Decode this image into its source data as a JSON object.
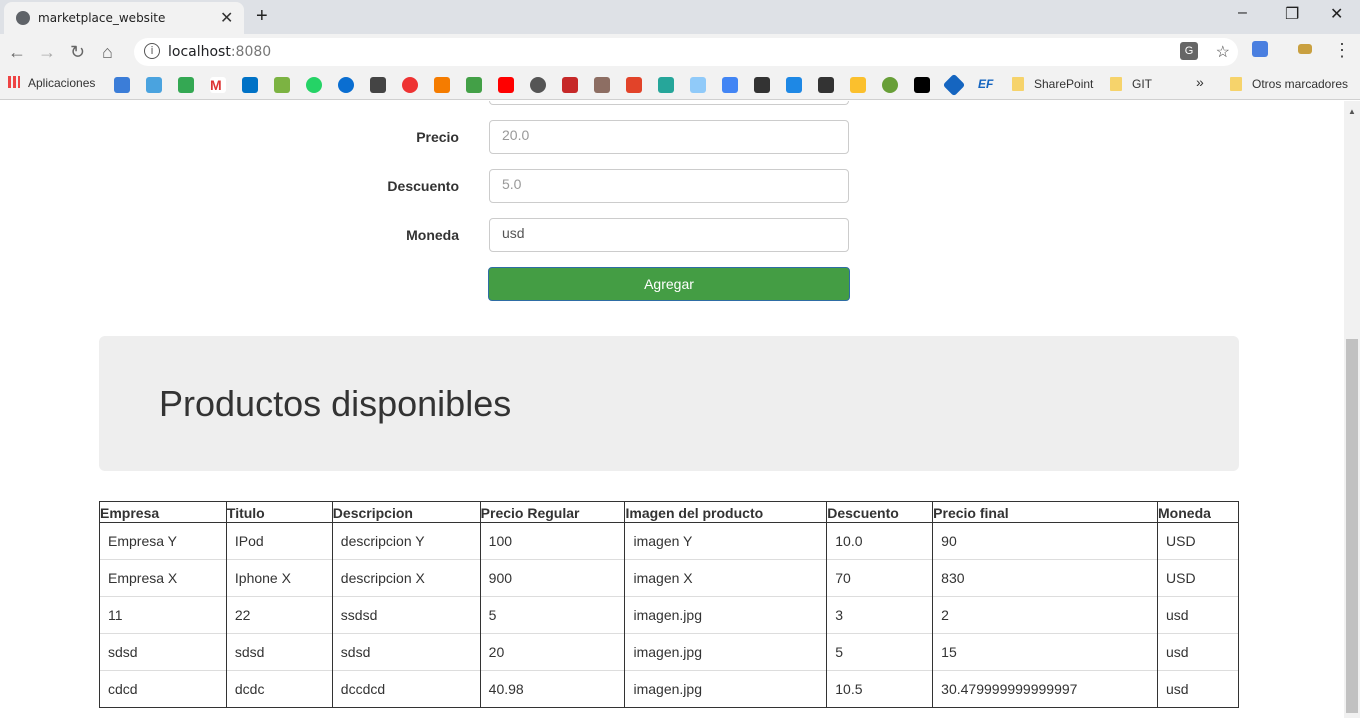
{
  "browser": {
    "tab_title": "marketplace_website",
    "url_host": "localhost",
    "url_port": ":8080",
    "bookmarks": {
      "apps_label": "Aplicaciones",
      "folders": [
        "SharePoint",
        "GIT"
      ],
      "more": "»",
      "other_label": "Otros marcadores"
    }
  },
  "form": {
    "fields": [
      {
        "label": "Precio",
        "value": "20.0"
      },
      {
        "label": "Descuento",
        "value": "5.0"
      },
      {
        "label": "Moneda",
        "value": "usd"
      }
    ],
    "submit_label": "Agregar"
  },
  "products": {
    "heading": "Productos disponibles",
    "columns": [
      "Empresa",
      "Titulo",
      "Descripcion",
      "Precio Regular",
      "Imagen del producto",
      "Descuento",
      "Precio final",
      "Moneda"
    ],
    "rows": [
      [
        "Empresa Y",
        "IPod",
        "descripcion Y",
        "100",
        "imagen Y",
        "10.0",
        "90",
        "USD"
      ],
      [
        "Empresa X",
        "Iphone X",
        "descripcion X",
        "900",
        "imagen X",
        "70",
        "830",
        "USD"
      ],
      [
        "11",
        "22",
        "ssdsd",
        "5",
        "imagen.jpg",
        "3",
        "2",
        "usd"
      ],
      [
        "sdsd",
        "sdsd",
        "sdsd",
        "20",
        "imagen.jpg",
        "5",
        "15",
        "usd"
      ],
      [
        "cdcd",
        "dcdc",
        "dccdcd",
        "40.98",
        "imagen.jpg",
        "10.5",
        "30.479999999999997",
        "usd"
      ]
    ]
  }
}
